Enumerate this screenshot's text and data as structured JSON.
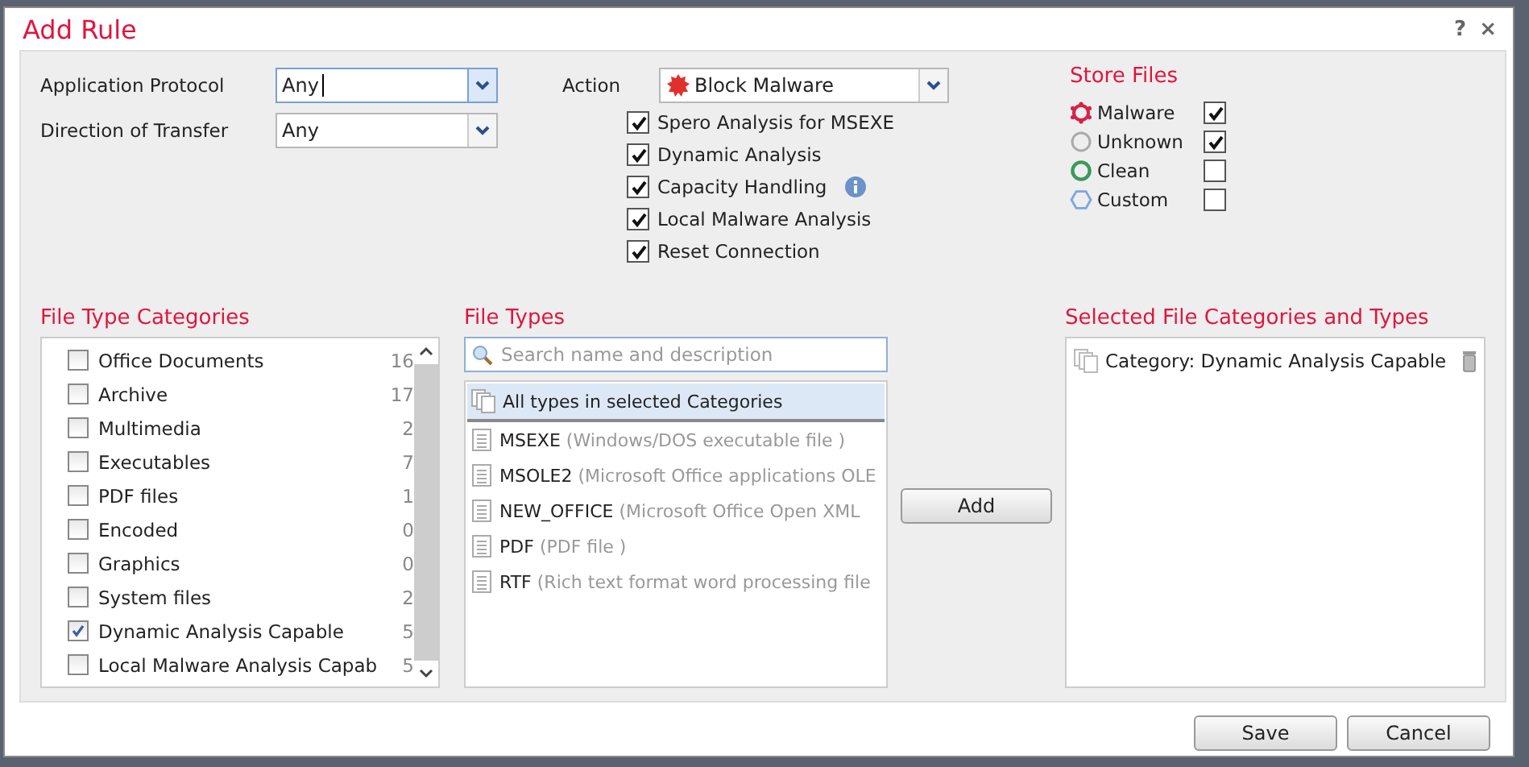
{
  "dialog": {
    "title": "Add Rule",
    "help": "?",
    "close": "×"
  },
  "application_protocol": {
    "label": "Application Protocol",
    "value": "Any",
    "focused": true
  },
  "direction_of_transfer": {
    "label": "Direction of Transfer",
    "value": "Any",
    "focused": false
  },
  "action": {
    "label": "Action",
    "value": "Block Malware"
  },
  "action_options": [
    {
      "label": "Spero Analysis for MSEXE",
      "checked": true,
      "info": false
    },
    {
      "label": "Dynamic Analysis",
      "checked": true,
      "info": false
    },
    {
      "label": "Capacity Handling",
      "checked": true,
      "info": true
    },
    {
      "label": "Local Malware Analysis",
      "checked": true,
      "info": false
    },
    {
      "label": "Reset Connection",
      "checked": true,
      "info": false
    }
  ],
  "store_files": {
    "title": "Store Files",
    "items": [
      {
        "kind": "malware",
        "label": "Malware",
        "checked": true
      },
      {
        "kind": "unknown",
        "label": "Unknown",
        "checked": true
      },
      {
        "kind": "clean",
        "label": "Clean",
        "checked": false
      },
      {
        "kind": "custom",
        "label": "Custom",
        "checked": false
      }
    ]
  },
  "file_type_categories": {
    "title": "File Type Categories",
    "items": [
      {
        "label": "Office Documents",
        "count": "16",
        "checked": false
      },
      {
        "label": "Archive",
        "count": "17",
        "checked": false
      },
      {
        "label": "Multimedia",
        "count": "2",
        "checked": false
      },
      {
        "label": "Executables",
        "count": "7",
        "checked": false
      },
      {
        "label": "PDF files",
        "count": "1",
        "checked": false
      },
      {
        "label": "Encoded",
        "count": "0",
        "checked": false
      },
      {
        "label": "Graphics",
        "count": "0",
        "checked": false
      },
      {
        "label": "System files",
        "count": "2",
        "checked": false
      },
      {
        "label": "Dynamic Analysis Capable",
        "count": "5",
        "checked": true
      },
      {
        "label": "Local Malware Analysis Capab",
        "count": "5",
        "checked": false
      }
    ]
  },
  "file_types": {
    "title": "File Types",
    "search": {
      "placeholder": "Search name and description"
    },
    "items": [
      {
        "kind": "group",
        "name": "All types in selected Categories",
        "selected": true
      },
      {
        "kind": "type",
        "name": "MSEXE",
        "description": "(Windows/DOS executable file )",
        "selected": false
      },
      {
        "kind": "type",
        "name": "MSOLE2",
        "description": "(Microsoft Office applications OLE",
        "selected": false
      },
      {
        "kind": "type",
        "name": "NEW_OFFICE",
        "description": "(Microsoft Office Open XML",
        "selected": false
      },
      {
        "kind": "type",
        "name": "PDF",
        "description": "(PDF file )",
        "selected": false
      },
      {
        "kind": "type",
        "name": "RTF",
        "description": "(Rich text format word processing file",
        "selected": false
      }
    ]
  },
  "add_button": "Add",
  "selected_list": {
    "title": "Selected File Categories and Types",
    "items": [
      {
        "label": "Category: Dynamic Analysis Capable"
      }
    ]
  },
  "buttons": [
    "Save",
    "Cancel"
  ]
}
